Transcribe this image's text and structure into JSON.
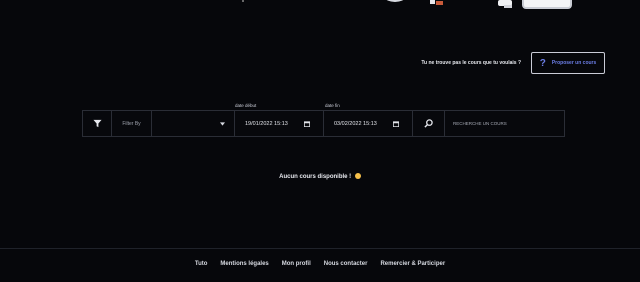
{
  "propose": {
    "question": "Tu ne trouve pas le cours que tu voulais ?",
    "icon": "question-mark-icon",
    "button_label": "Proposer un cours"
  },
  "filters": {
    "filter_icon": "filter-funnel-icon",
    "filter_by_label": "Filter By",
    "select_value": "",
    "select_icon": "dropdown-caret-icon",
    "date_start_label": "date début",
    "date_start_value": "19/01/2022 15:13",
    "date_end_label": "date fin",
    "date_end_value": "03/02/2022 15:13",
    "calendar_icon": "calendar-icon",
    "search_icon": "magnifier-icon",
    "search_placeholder": "RECHERCHE UN COURS"
  },
  "main": {
    "empty_message": "Aucun cours disponible !",
    "empty_emoji": "sad-face-icon"
  },
  "footer": {
    "links": [
      "Tuto",
      "Mentions légales",
      "Mon profil",
      "Nous contacter",
      "Remercier & Participer"
    ]
  },
  "colors": {
    "background": "#06070b",
    "accent": "#6c7ee6",
    "border": "#2a2d36"
  }
}
